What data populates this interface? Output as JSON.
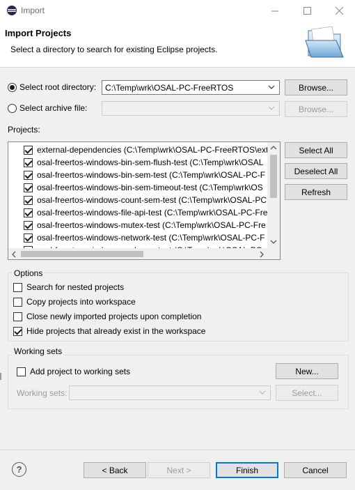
{
  "window": {
    "title": "Import"
  },
  "header": {
    "title": "Import Projects",
    "description": "Select a directory to search for existing Eclipse projects."
  },
  "source": {
    "root_label": "Select root directory:",
    "root_value": "C:\\Temp\\wrk\\OSAL-PC-FreeRTOS",
    "archive_label": "Select archive file:",
    "archive_value": "",
    "browse_label": "Browse...",
    "browse_archive_label": "Browse..."
  },
  "projects": {
    "label": "Projects:",
    "items": [
      {
        "label": "external-dependencies (C:\\Temp\\wrk\\OSAL-PC-FreeRTOS\\exter",
        "checked": true
      },
      {
        "label": "osal-freertos-windows-bin-sem-flush-test (C:\\Temp\\wrk\\OSAL",
        "checked": true
      },
      {
        "label": "osal-freertos-windows-bin-sem-test (C:\\Temp\\wrk\\OSAL-PC-F",
        "checked": true
      },
      {
        "label": "osal-freertos-windows-bin-sem-timeout-test (C:\\Temp\\wrk\\OS",
        "checked": true
      },
      {
        "label": "osal-freertos-windows-count-sem-test (C:\\Temp\\wrk\\OSAL-PC",
        "checked": true
      },
      {
        "label": "osal-freertos-windows-file-api-test (C:\\Temp\\wrk\\OSAL-PC-Fre",
        "checked": true
      },
      {
        "label": "osal-freertos-windows-mutex-test (C:\\Temp\\wrk\\OSAL-PC-Fre",
        "checked": true
      },
      {
        "label": "osal-freertos-windows-network-test (C:\\Temp\\wrk\\OSAL-PC-F",
        "checked": true
      },
      {
        "label": "osal-freertos-windows-osal-core-test (C:\\Temp\\wrk\\OSAL-PC",
        "checked": true
      }
    ],
    "select_all_label": "Select All",
    "deselect_all_label": "Deselect All",
    "refresh_label": "Refresh"
  },
  "options": {
    "title": "Options",
    "items": [
      {
        "label": "Search for nested projects",
        "checked": false
      },
      {
        "label": "Copy projects into workspace",
        "checked": false
      },
      {
        "label": "Close newly imported projects upon completion",
        "checked": false
      },
      {
        "label": "Hide projects that already exist in the workspace",
        "checked": true
      }
    ]
  },
  "working_sets": {
    "title": "Working sets",
    "add_label": "Add project to working sets",
    "add_checked": false,
    "new_label": "New...",
    "sets_label": "Working sets:",
    "sets_value": "",
    "select_label": "Select..."
  },
  "footer": {
    "back_label": "< Back",
    "next_label": "Next >",
    "finish_label": "Finish",
    "cancel_label": "Cancel"
  }
}
